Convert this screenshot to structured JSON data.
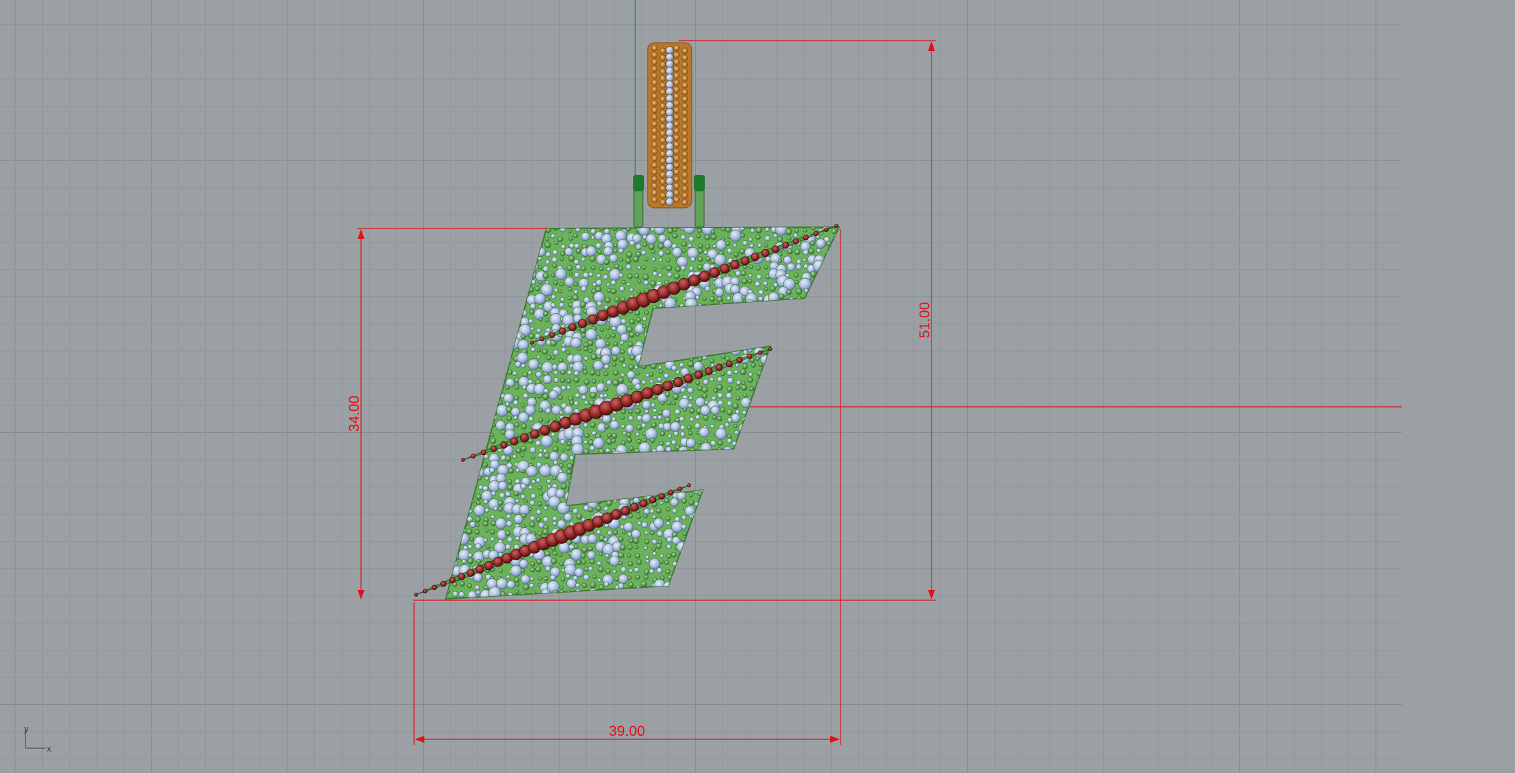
{
  "viewport": {
    "background": "#9ba0a4",
    "grid_minor_color": "#8f959a",
    "grid_major_color": "#858b90",
    "dimension_color": "#e0101a",
    "metal_color": "#6bb35a",
    "bail_color": "#c9842c",
    "ruby_color": "#8e2424",
    "diamond_color": "#b7c9e6"
  },
  "dimensions": {
    "total_height": "51.00",
    "letter_height": "34.00",
    "width": "39.00"
  },
  "axis_widget": {
    "x_label": "x",
    "y_label": "y"
  },
  "model": {
    "name_icon": "letter-e-pendant-icon"
  }
}
